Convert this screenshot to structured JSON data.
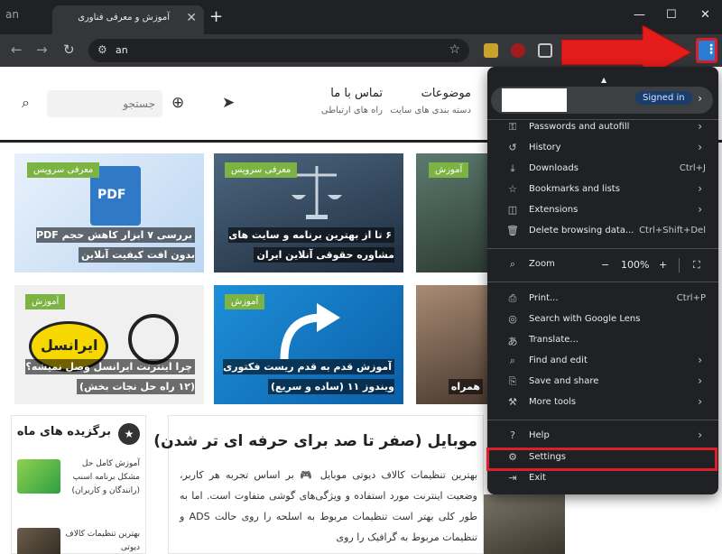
{
  "browser": {
    "tab_left_text": "an",
    "tab_title": "آموزش و معرفی فناوری",
    "tab_close": "✕",
    "new_tab": "+",
    "window_controls": [
      "—",
      "☐",
      "✕"
    ],
    "address": "an",
    "highlight_color": "#d9202b",
    "arrow_color": "#e41c1c"
  },
  "site": {
    "search_placeholder": "جستجو",
    "nav": [
      {
        "main": "تماس با ما",
        "sub": "راه های ارتباطی"
      },
      {
        "main": "موضوعات",
        "sub": "دسته بندی های سایت"
      }
    ],
    "cards": [
      {
        "tag": "معرفی سرویس",
        "title": "بررسی ۷ ابزار کاهش حجم PDF بدون افت کیفیت آنلاین",
        "image_text": "PDF"
      },
      {
        "tag": "معرفی سرویس",
        "title": "۶ تا از بهترین برنامه و سایت های مشاوره حقوقی آنلاین ایران"
      },
      {
        "tag": "آموزش",
        "title": "همراه"
      },
      {
        "tag": "آموزش",
        "title": "چرا اینترنت ایرانسل وصل نمیشه؟ (۱۲ راه حل نجات بخش)",
        "image_text": "ایرانسل"
      },
      {
        "tag": "آموزش",
        "title": "آموزش قدم به قدم ریست فکتوری ویندوز ۱۱ (ساده و سریع)"
      }
    ],
    "sidebar": {
      "title": "برگزیده های ماه",
      "items": [
        {
          "text": "آموزش کامل حل مشکل برنامه اسنپ (رانندگان و کاربران)"
        },
        {
          "text": "بهترین تنظیمات کالاف دیوتی"
        }
      ]
    },
    "article": {
      "title": "موبایل (صفر تا صد برای حرفه ای تر شدن)",
      "body": "بهترین تنظیمات کالاف دیوتی موبایل 🎮 بر اساس تجربه هر کاربر، وضعیت اینترنت مورد استفاده و ویژگی‌های گوشی متفاوت است. اما به طور کلی بهتر است تنظیمات مربوط به اسلحه را روی حالت ADS و تنظیمات مربوط به گرافیک را روی"
    }
  },
  "menu": {
    "signed_in": "Signed in",
    "zoom_label": "Zoom",
    "zoom_value": "100%",
    "zoom_minus": "−",
    "zoom_plus": "+",
    "items": [
      {
        "label": "Passwords and autofill",
        "icon": "key-icon",
        "chevron": true
      },
      {
        "label": "History",
        "icon": "history-icon",
        "chevron": true
      },
      {
        "label": "Downloads",
        "icon": "download-icon",
        "shortcut": "Ctrl+J"
      },
      {
        "label": "Bookmarks and lists",
        "icon": "star-icon",
        "chevron": true
      },
      {
        "label": "Extensions",
        "icon": "puzzle-icon",
        "chevron": true
      },
      {
        "label": "Delete browsing data...",
        "icon": "trash-icon",
        "shortcut": "Ctrl+Shift+Del"
      },
      {
        "label": "Print...",
        "icon": "print-icon",
        "shortcut": "Ctrl+P"
      },
      {
        "label": "Search with Google Lens",
        "icon": "lens-icon"
      },
      {
        "label": "Translate...",
        "icon": "translate-icon"
      },
      {
        "label": "Find and edit",
        "icon": "find-icon",
        "chevron": true
      },
      {
        "label": "Save and share",
        "icon": "share-icon",
        "chevron": true
      },
      {
        "label": "More tools",
        "icon": "tools-icon",
        "chevron": true
      },
      {
        "label": "Help",
        "icon": "help-icon",
        "chevron": true
      },
      {
        "label": "Settings",
        "icon": "gear-icon"
      },
      {
        "label": "Exit",
        "icon": "exit-icon"
      }
    ]
  }
}
